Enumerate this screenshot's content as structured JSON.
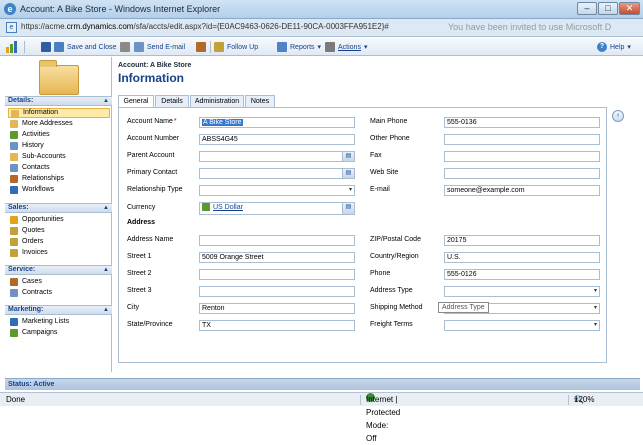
{
  "window": {
    "title": "Account: A Bike Store - Windows Internet Explorer",
    "url_prefix": "https://acme.",
    "url_domain": "crm.dynamics.com",
    "url_path": "/sfa/accts/edit.aspx?id={E0AC9463-0626-DE11-90CA-0003FFA951E2}#",
    "notification": "You have been invited to use Microsoft D"
  },
  "toolbar": {
    "save_label": "Save and Close",
    "send_email_label": "Send E-mail",
    "follow_up_label": "Follow Up",
    "reports_label": "Reports",
    "actions_label": "Actions",
    "help_label": "Help"
  },
  "sidebar": {
    "details_header": "Details:",
    "details_items": [
      "Information",
      "More Addresses",
      "Activities",
      "History",
      "Sub-Accounts",
      "Contacts",
      "Relationships",
      "Workflows"
    ],
    "sales_header": "Sales:",
    "sales_items": [
      "Opportunities",
      "Quotes",
      "Orders",
      "Invoices"
    ],
    "service_header": "Service:",
    "service_items": [
      "Cases",
      "Contracts"
    ],
    "marketing_header": "Marketing:",
    "marketing_items": [
      "Marketing Lists",
      "Campaigns"
    ]
  },
  "header": {
    "entity": "Account: A Bike Store",
    "section": "Information"
  },
  "tabs": [
    "General",
    "Details",
    "Administration",
    "Notes"
  ],
  "form": {
    "account_name_label": "Account Name",
    "account_name_value": "A Bike Store",
    "account_number_label": "Account Number",
    "account_number_value": "ABSS4G45",
    "parent_account_label": "Parent Account",
    "parent_account_value": "",
    "primary_contact_label": "Primary Contact",
    "primary_contact_value": "",
    "relationship_type_label": "Relationship Type",
    "relationship_type_value": "",
    "currency_label": "Currency",
    "currency_value": "US Dollar",
    "main_phone_label": "Main Phone",
    "main_phone_value": "555-0136",
    "other_phone_label": "Other Phone",
    "other_phone_value": "",
    "fax_label": "Fax",
    "fax_value": "",
    "web_site_label": "Web Site",
    "web_site_value": "",
    "email_label": "E-mail",
    "email_value": "someone@example.com",
    "address_section": "Address",
    "address_name_label": "Address Name",
    "address_name_value": "",
    "street1_label": "Street 1",
    "street1_value": "5009 Orange Street",
    "street2_label": "Street 2",
    "street2_value": "",
    "street3_label": "Street 3",
    "street3_value": "",
    "city_label": "City",
    "city_value": "Renton",
    "state_label": "State/Province",
    "state_value": "TX",
    "zip_label": "ZIP/Postal Code",
    "zip_value": "20175",
    "country_label": "Country/Region",
    "country_value": "U.S.",
    "phone_label": "Phone",
    "phone_value": "555-0126",
    "address_type_label": "Address Type",
    "address_type_value": "",
    "shipping_method_label": "Shipping Method",
    "shipping_method_value": "",
    "freight_terms_label": "Freight Terms",
    "freight_terms_value": ""
  },
  "tooltip": "Address Type",
  "status": {
    "text": "Status: Active"
  },
  "ie_status": {
    "done": "Done",
    "zone": "Internet | Protected Mode: Off",
    "zoom": "120%"
  }
}
